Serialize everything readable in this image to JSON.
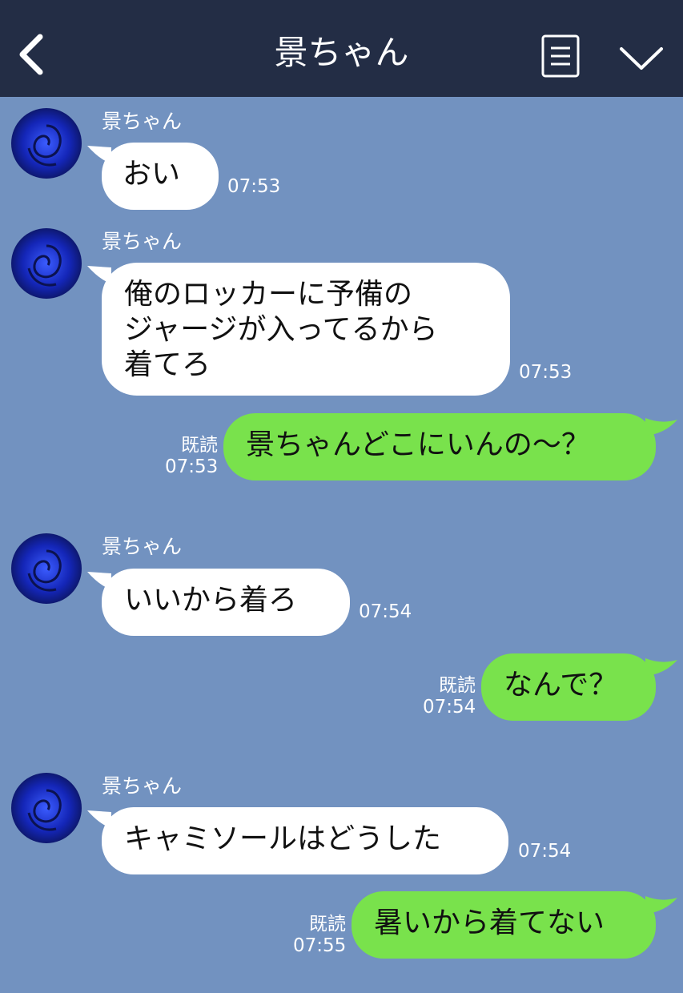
{
  "header": {
    "title": "景ちゃん"
  },
  "messages": [
    {
      "direction": "in",
      "sender": "景ちゃん",
      "lines": [
        "おい"
      ],
      "time": "07:53"
    },
    {
      "direction": "in",
      "sender": "景ちゃん",
      "lines": [
        "俺のロッカーに予備の",
        "ジャージが入ってるから",
        "着てろ"
      ],
      "time": "07:53"
    },
    {
      "direction": "out",
      "read": "既読",
      "lines": [
        "景ちゃんどこにいんの〜？"
      ],
      "time": "07:53"
    },
    {
      "direction": "in",
      "sender": "景ちゃん",
      "lines": [
        "いいから着ろ"
      ],
      "time": "07:54"
    },
    {
      "direction": "out",
      "read": "既読",
      "lines": [
        "なんで？"
      ],
      "time": "07:54"
    },
    {
      "direction": "in",
      "sender": "景ちゃん",
      "lines": [
        "キャミソールはどうした"
      ],
      "time": "07:54"
    },
    {
      "direction": "out",
      "read": "既読",
      "lines": [
        "暑いから着てない"
      ],
      "time": "07:55"
    }
  ],
  "colors": {
    "header_bg": "#232d45",
    "chat_bg": "#7292c0",
    "outgoing_bubble": "#79e24c",
    "incoming_bubble": "#ffffff"
  },
  "icons": {
    "back": "chevron-left-icon",
    "menu": "menu-icon",
    "collapse": "chevron-down-icon",
    "avatar": "blue-rose-avatar"
  }
}
